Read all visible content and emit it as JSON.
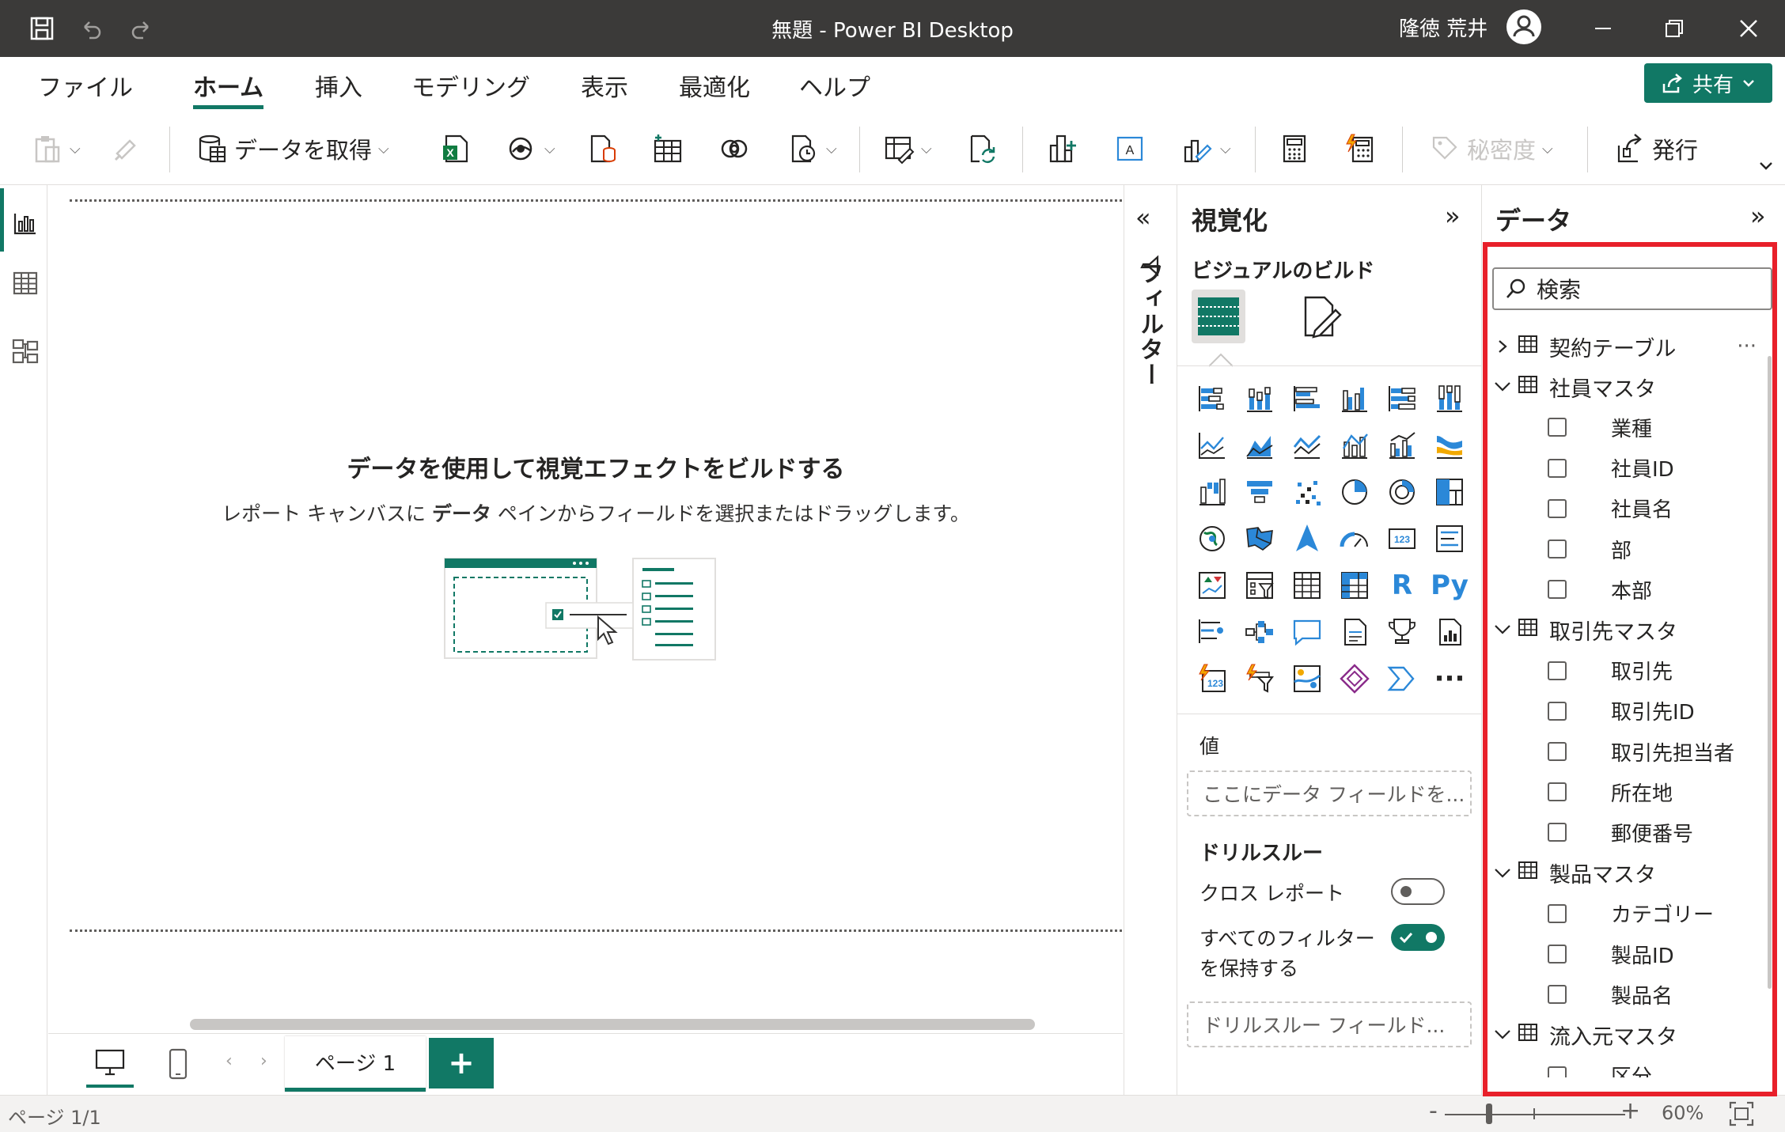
{
  "window": {
    "title": "無題 - Power BI Desktop",
    "user_name": "隆徳 荒井"
  },
  "menu": {
    "tabs": [
      {
        "label": "ファイル"
      },
      {
        "label": "ホーム",
        "active": true
      },
      {
        "label": "挿入"
      },
      {
        "label": "モデリング"
      },
      {
        "label": "表示"
      },
      {
        "label": "最適化"
      },
      {
        "label": "ヘルプ"
      }
    ],
    "share_label": "共有"
  },
  "ribbon": {
    "get_data_label": "データを取得",
    "sensitivity_label": "秘密度",
    "publish_label": "発行"
  },
  "canvas": {
    "empty_title": "データを使用して視覚エフェクトをビルドする",
    "empty_sub_before": "レポート キャンバスに ",
    "empty_sub_bold": "データ",
    "empty_sub_after": " ペインからフィールドを選択またはドラッグします。"
  },
  "pages": {
    "tabs": [
      "ページ 1"
    ],
    "add_label": "+"
  },
  "status": {
    "page_indicator": "ページ 1/1",
    "zoom_minus": "-",
    "zoom_plus": "+",
    "zoom_level": "60%"
  },
  "filters": {
    "label": "フィルター"
  },
  "visualizations": {
    "title": "視覚化",
    "subtitle": "ビジュアルのビルド",
    "values_label": "値",
    "values_placeholder": "ここにデータ フィールドを...",
    "drillthrough_heading": "ドリルスルー",
    "cross_report_label": "クロス レポート",
    "cross_report_on": false,
    "keep_filters_label": "すべてのフィルターを保持する",
    "keep_filters_on": true,
    "drill_placeholder": "ドリルスルー フィールド...",
    "icons": [
      "stacked-bar-icon",
      "stacked-column-icon",
      "clustered-bar-icon",
      "clustered-column-icon",
      "100-stacked-bar-icon",
      "100-stacked-column-icon",
      "line-chart-icon",
      "area-chart-icon",
      "stacked-area-icon",
      "line-column-icon",
      "line-clustered-column-icon",
      "ribbon-chart-icon",
      "waterfall-icon",
      "funnel-icon",
      "scatter-icon",
      "pie-icon",
      "donut-icon",
      "treemap-icon",
      "map-icon",
      "filled-map-icon",
      "azure-map-icon",
      "gauge-icon",
      "card-icon",
      "multi-row-card-icon",
      "kpi-icon",
      "slicer-icon",
      "table-icon",
      "matrix-icon",
      "r-visual-icon",
      "python-visual-icon",
      "key-influencers-icon",
      "decomposition-tree-icon",
      "qa-icon",
      "narrative-icon",
      "goals-icon",
      "paginated-report-icon",
      "power-apps-icon",
      "power-automate-icon",
      "arcgis-icon",
      "diamond-visual-icon",
      "chevron-visual-icon",
      "more-visuals-icon"
    ],
    "r_label": "R",
    "py_label": "Py",
    "more_label": "···"
  },
  "data": {
    "title": "データ",
    "search_placeholder": "検索",
    "more_label": "···",
    "tables": [
      {
        "name": "契約テーブル",
        "expanded": false,
        "fields": []
      },
      {
        "name": "社員マスタ",
        "expanded": true,
        "fields": [
          "業種",
          "社員ID",
          "社員名",
          "部",
          "本部"
        ]
      },
      {
        "name": "取引先マスタ",
        "expanded": true,
        "fields": [
          "取引先",
          "取引先ID",
          "取引先担当者",
          "所在地",
          "郵便番号"
        ]
      },
      {
        "name": "製品マスタ",
        "expanded": true,
        "fields": [
          "カテゴリー",
          "製品ID",
          "製品名"
        ]
      },
      {
        "name": "流入元マスタ",
        "expanded": true,
        "fields": [
          "区分"
        ]
      }
    ]
  },
  "colors": {
    "accent": "#117865",
    "titlebar": "#3b3a39",
    "highlight": "#e8202a",
    "visual_blue": "#2b88d8"
  }
}
